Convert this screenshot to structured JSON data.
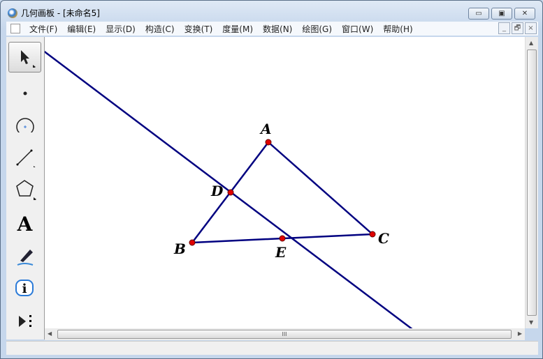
{
  "window": {
    "title": "几何画板 - [未命名5]",
    "min": "▭",
    "max": "▣",
    "close": "✕"
  },
  "menu": [
    "文件(F)",
    "编辑(E)",
    "显示(D)",
    "构造(C)",
    "变换(T)",
    "度量(M)",
    "数据(N)",
    "绘图(G)",
    "窗口(W)",
    "帮助(H)"
  ],
  "mdi": {
    "min": "_",
    "restore": "🗗",
    "close": "×"
  },
  "tools": [
    "arrow-select-tool",
    "point-tool",
    "compass-tool",
    "straightedge-tool",
    "polygon-tool",
    "text-tool",
    "marker-tool",
    "information-tool",
    "custom-tool"
  ],
  "text_tool_glyph": "A",
  "info_glyph": "i",
  "points": {
    "A": "A",
    "B": "B",
    "C": "C",
    "D": "D",
    "E": "E"
  },
  "colors": {
    "line": "#000080",
    "point": "#e00000"
  },
  "hscroll_grip": "III"
}
